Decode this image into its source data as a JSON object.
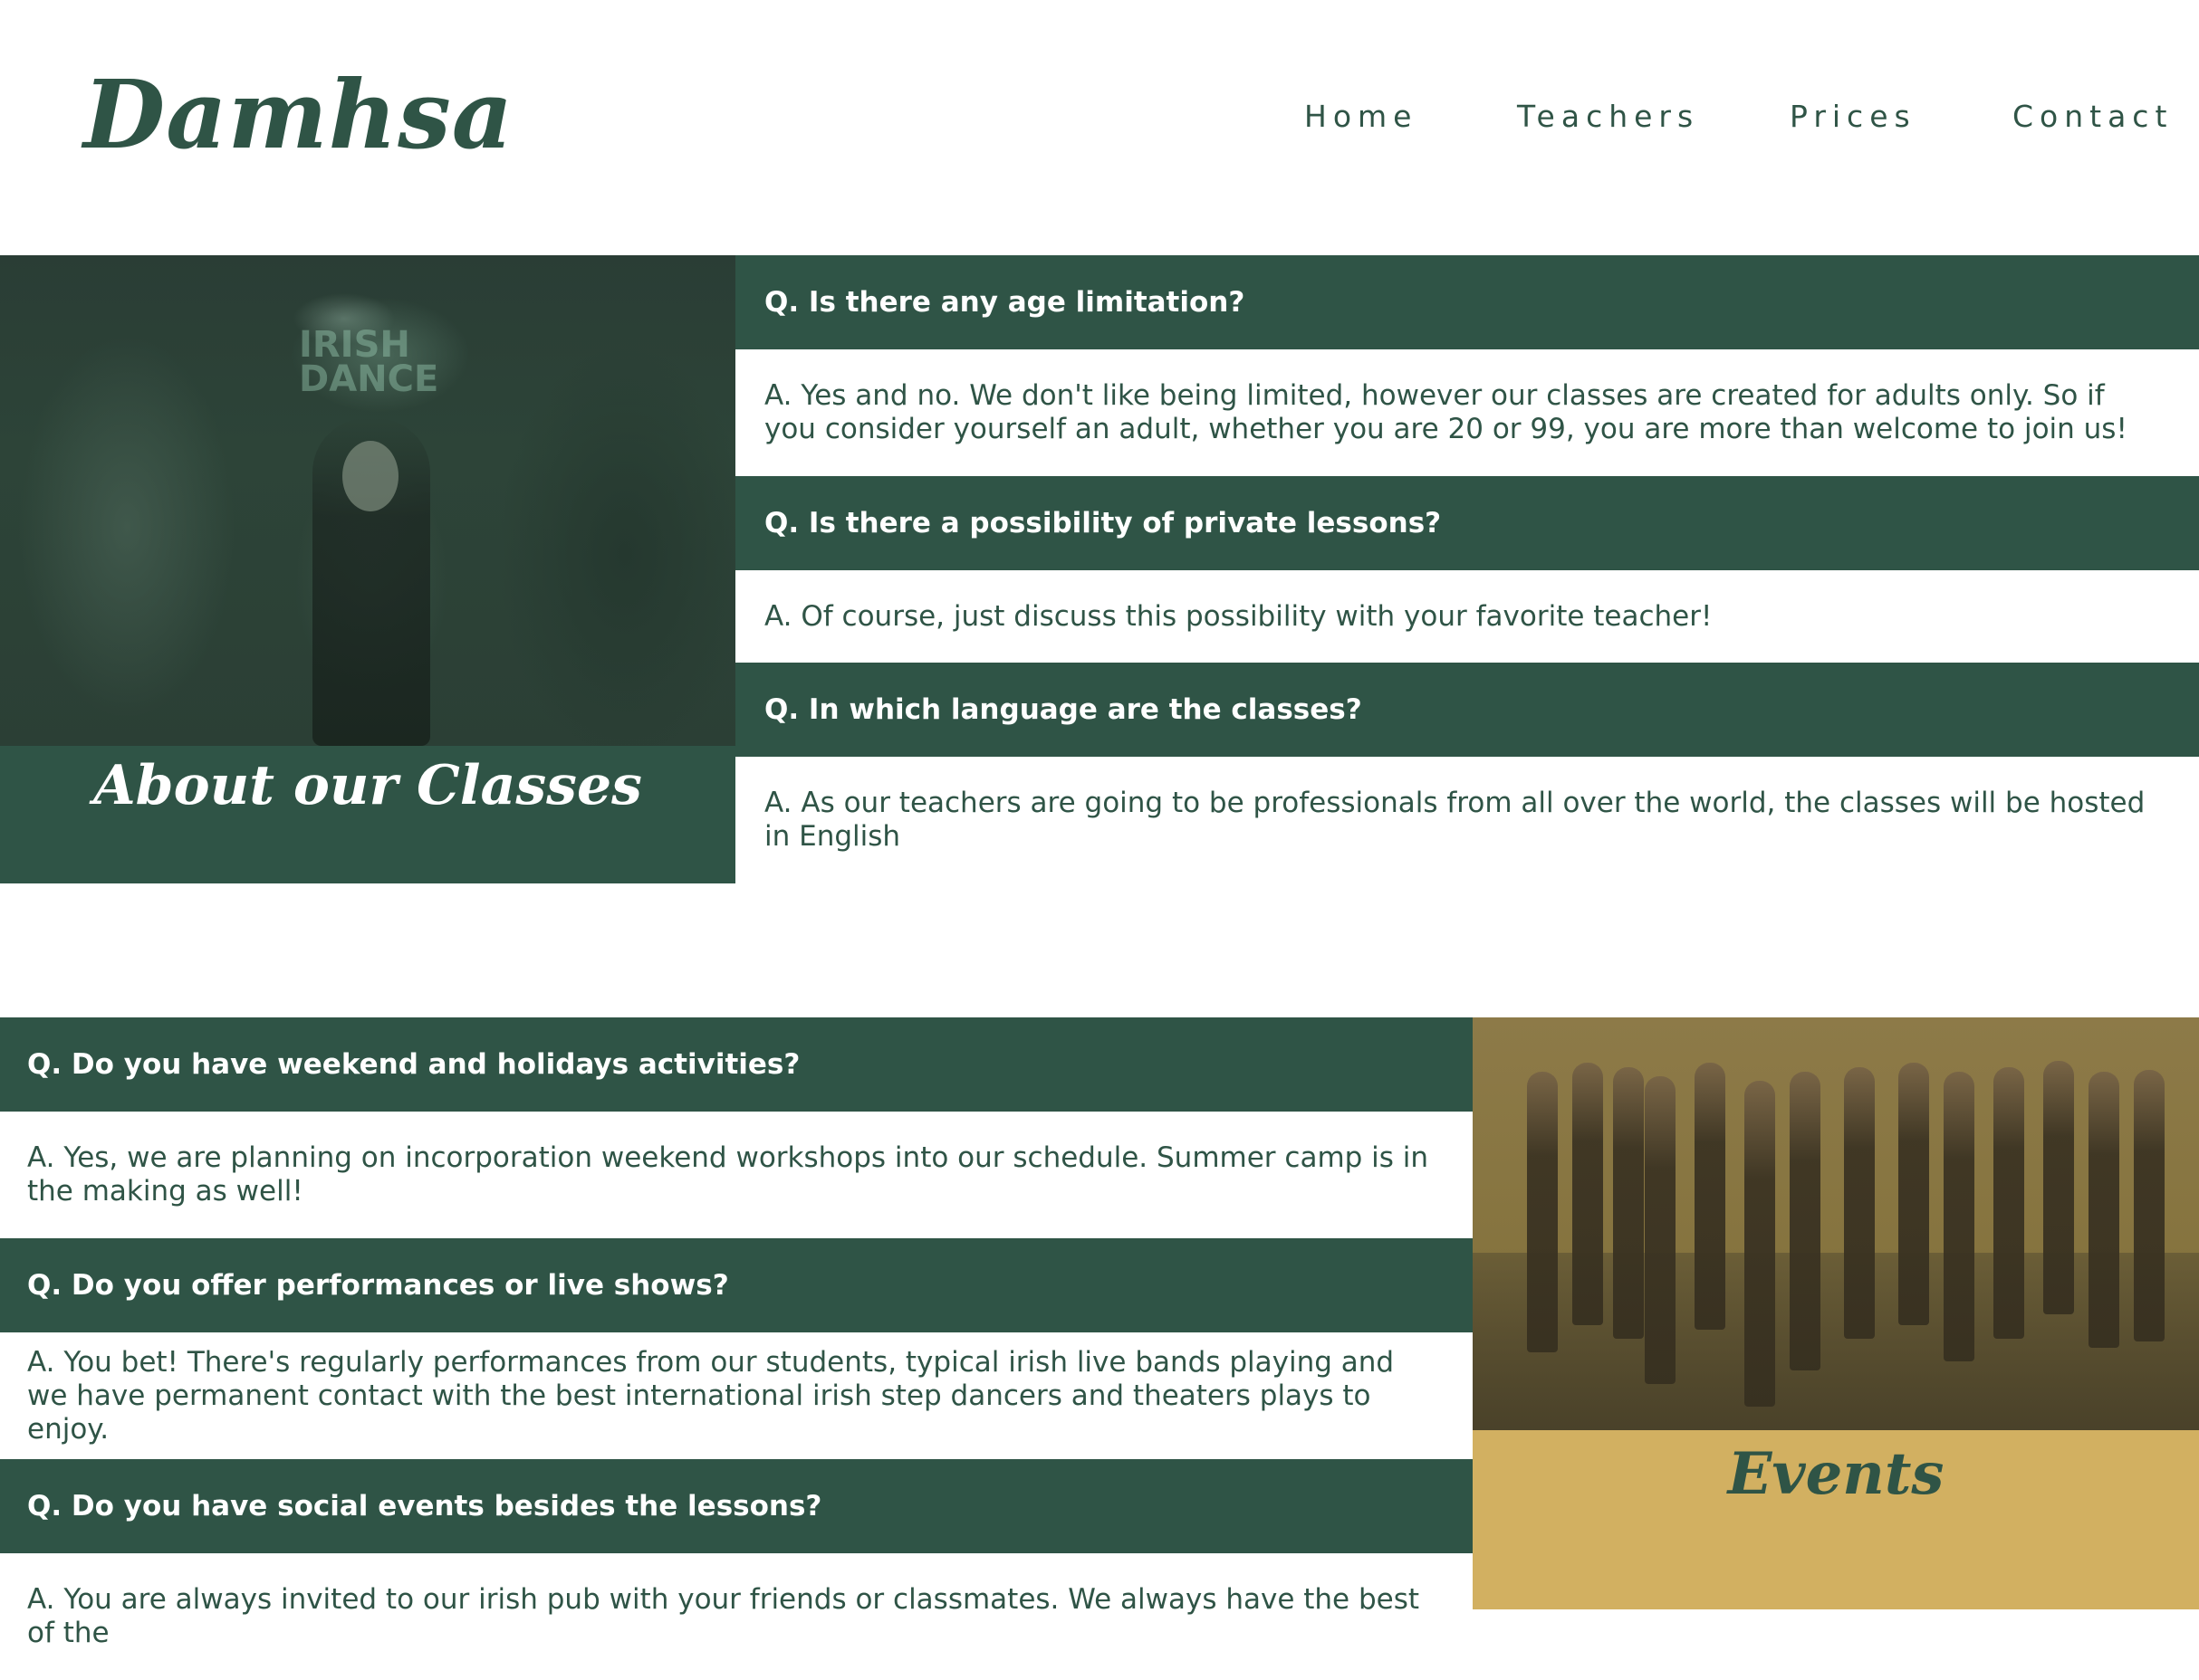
{
  "header": {
    "logo": "Damhsa",
    "nav": [
      "Home",
      "Teachers",
      "Prices",
      "Contact"
    ]
  },
  "about": {
    "title": "About our Classes",
    "sign_text": "IRISH DANCE",
    "faqs": [
      {
        "q": "Q. Is there any age limitation?",
        "a": "A. Yes and no. We don't like being limited, however our classes are created for adults only. So if you consider yourself an adult, whether you are 20 or 99, you are more than welcome to join us!"
      },
      {
        "q": "Q. Is there a possibility of private lessons?",
        "a": "A. Of course, just discuss this possibility with your favorite teacher!"
      },
      {
        "q": "Q. In which language are the classes?",
        "a": "A. As our teachers are going to be professionals from all over the world, the classes will be hosted in English"
      }
    ]
  },
  "events": {
    "title": "Events",
    "faqs": [
      {
        "q": "Q. Do you have weekend and holidays activities?",
        "a": "A. Yes, we are planning on incorporation weekend workshops into our schedule. Summer camp is in the making as well!"
      },
      {
        "q": "Q. Do you offer performances or live shows?",
        "a": "A. You bet! There's regularly performances from our students, typical irish live bands playing and we have permanent contact with the best international irish step dancers and theaters plays to enjoy."
      },
      {
        "q": "Q. Do you have social events besides the lessons?",
        "a": "A. You are always invited to our irish pub with your friends or classmates. We always have the best of the"
      }
    ]
  },
  "colors": {
    "primary_green": "#2f5446",
    "gold": "#d2b061",
    "white": "#ffffff"
  }
}
